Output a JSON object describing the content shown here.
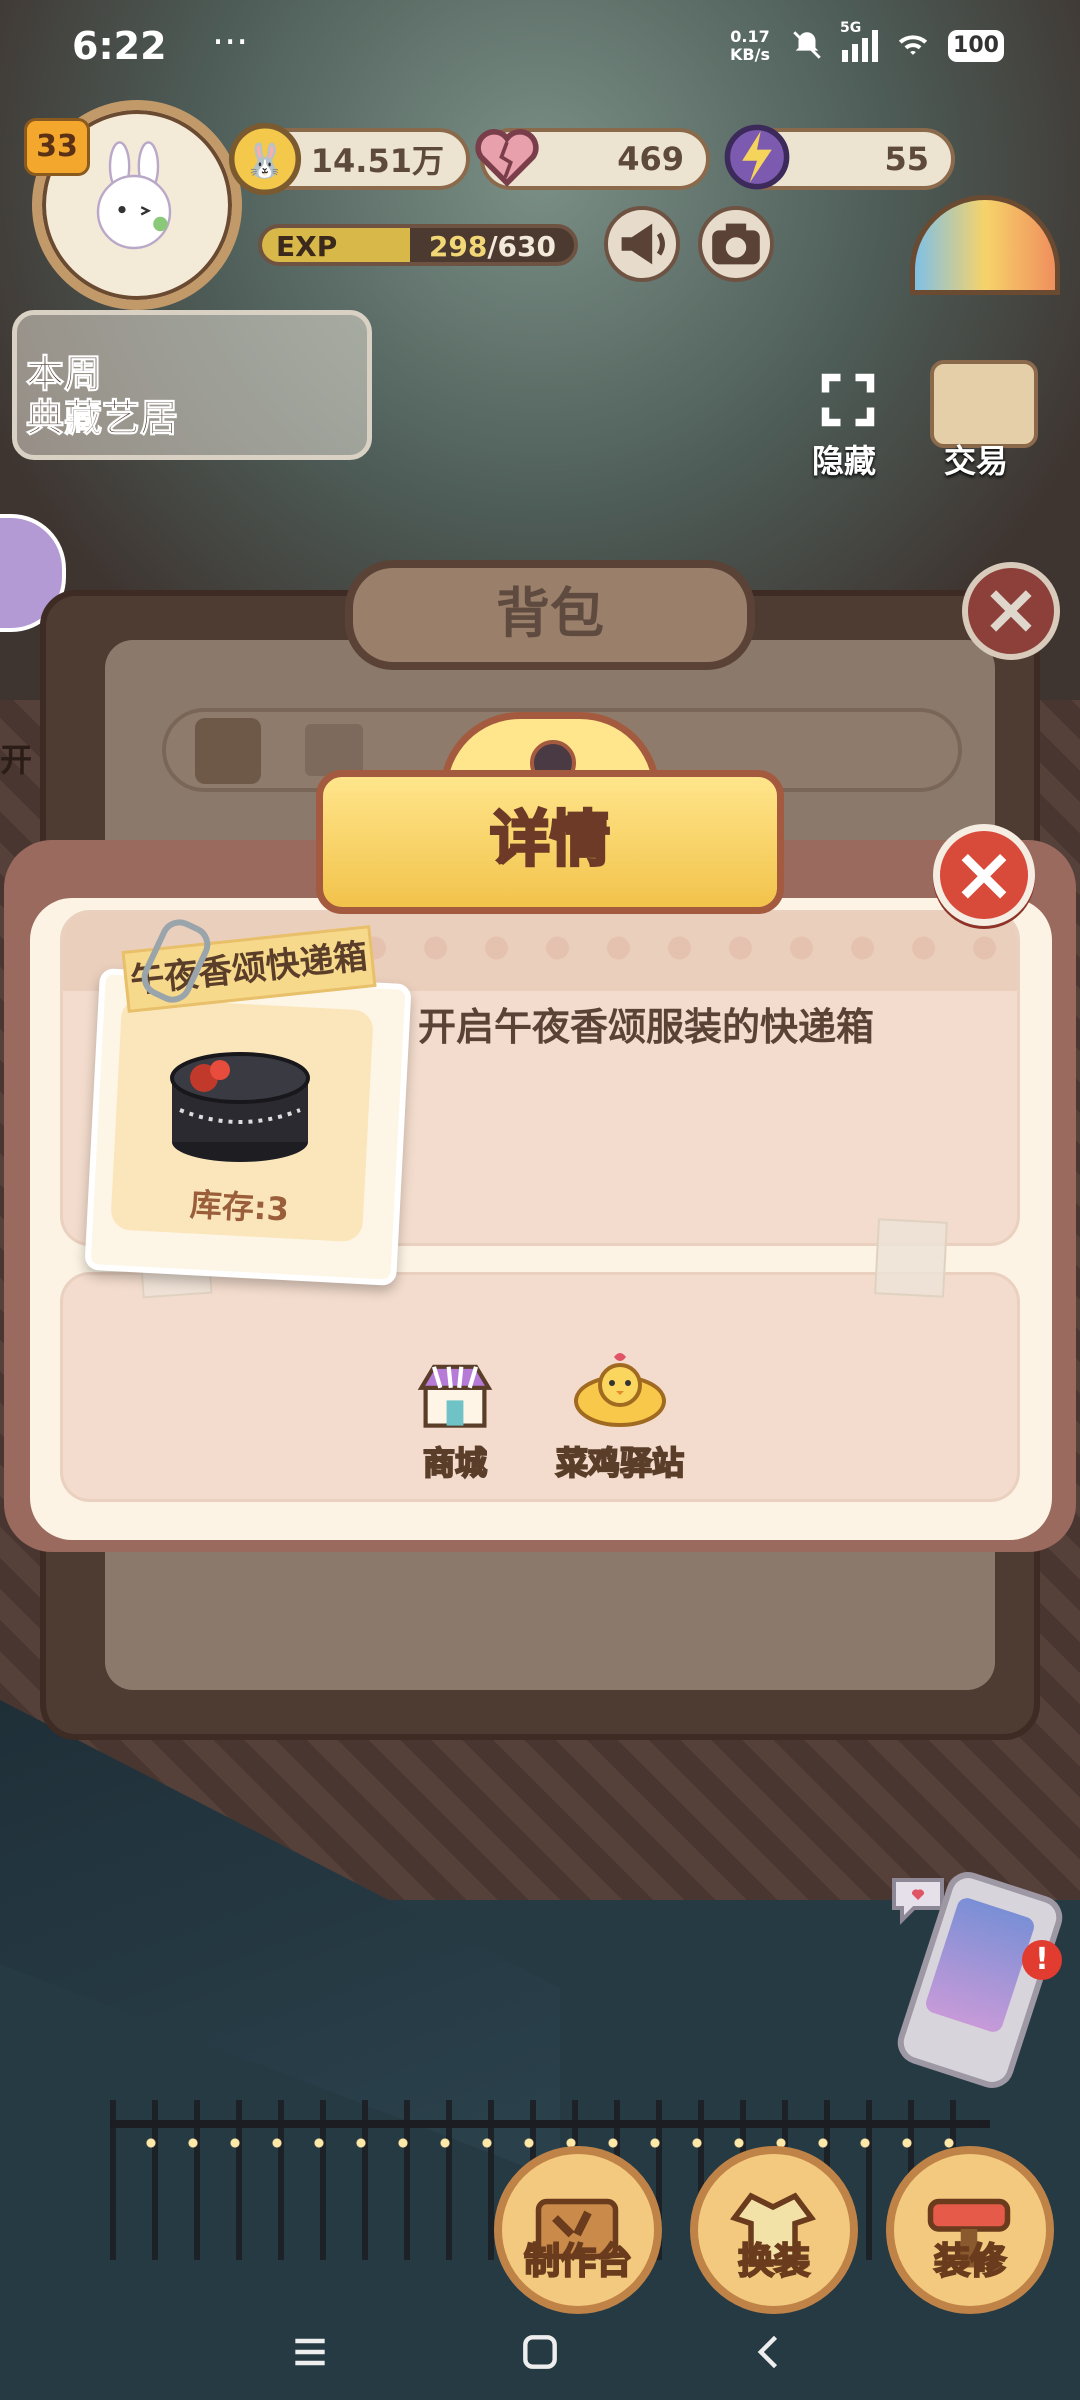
{
  "status_bar": {
    "time": "6:22",
    "more": "···",
    "net_speed_value": "0.17",
    "net_speed_unit": "KB/s",
    "network": "5G",
    "battery": "100"
  },
  "hud": {
    "level": "33",
    "coins": "14.51万",
    "hearts": "469",
    "energy": "55",
    "exp_label": "EXP",
    "exp_current": "298",
    "exp_max": "/630",
    "exp_progress": 0.473
  },
  "weekly_banner": {
    "line1": "本周",
    "line2": "典藏艺居"
  },
  "side_buttons": {
    "hide": "隐藏",
    "trade": "交易"
  },
  "backpack": {
    "title": "背包",
    "partial_left_label": "开"
  },
  "detail": {
    "title": "详情",
    "item_name": "午夜香颂快递箱",
    "description": "开启午夜香颂服装的快递箱",
    "stock": "库存:3",
    "sources": [
      {
        "label": "商城",
        "icon": "shop-icon"
      },
      {
        "label": "菜鸡驿站",
        "icon": "chick-station-icon"
      }
    ]
  },
  "bottom_actions": [
    {
      "label": "制作台",
      "icon": "workbench-icon"
    },
    {
      "label": "换装",
      "icon": "dress-up-icon"
    },
    {
      "label": "装修",
      "icon": "decorate-icon"
    }
  ],
  "colors": {
    "modal_title_fill": "#f2c34b",
    "close_red": "#d84a3a",
    "card_bg": "#fcf3e4"
  }
}
